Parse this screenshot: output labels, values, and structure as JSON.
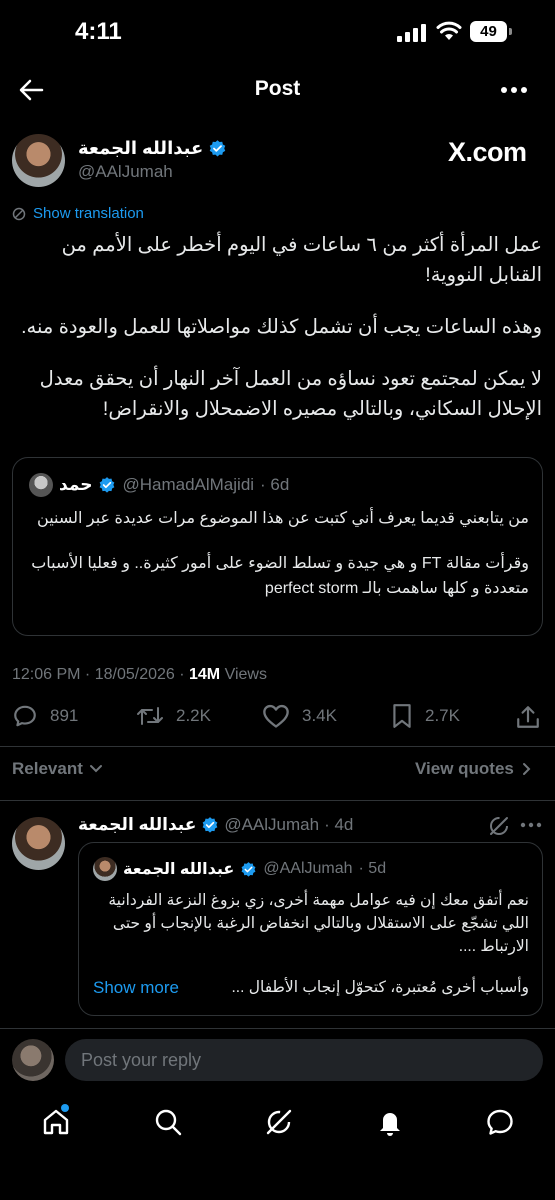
{
  "status_bar": {
    "time": "4:11",
    "battery": "49"
  },
  "header": {
    "title": "Post"
  },
  "post": {
    "display_name": "عبدالله الجمعة",
    "handle": "@AAlJumah",
    "watermark": "X.com",
    "translate_label": "Show translation",
    "paragraphs": [
      "عمل المرأة أكثر من ٦ ساعات في اليوم أخطر على الأمم من القنابل النووية!",
      "وهذه الساعات يجب أن تشمل كذلك مواصلاتها للعمل والعودة منه.",
      "لا يمكن لمجتمع تعود نساؤه من العمل آخر النهار أن يحقق معدل الإحلال السكاني، وبالتالي مصيره الاضمحلال والانقراض!"
    ],
    "quoted": {
      "display_name": "حمد",
      "handle": "@HamadAlMajidi",
      "time": "· 6d",
      "paragraphs": [
        "من يتابعني قديما يعرف أني كتبت عن هذا الموضوع مرات عديدة عبر السنين",
        "وقرأت مقالة FT و هي جيدة و تسلط الضوء على أمور كثيرة.. و فعليا الأسباب متعددة و كلها ساهمت بالـ perfect storm"
      ]
    },
    "meta": {
      "time_date": "12:06 PM · 18/05/2026 · ",
      "views_count": "14M",
      "views_label": " Views"
    },
    "stats": {
      "replies": "891",
      "reposts": "2.2K",
      "likes": "3.4K",
      "bookmarks": "2.7K"
    }
  },
  "sort": {
    "relevant_label": "Relevant",
    "view_quotes_label": "View quotes"
  },
  "reply": {
    "display_name": "عبدالله الجمعة",
    "handle": "@AAlJumah",
    "time": "· 4d",
    "quoted": {
      "display_name": "عبدالله الجمعة",
      "handle": "@AAlJumah",
      "time": "· 5d",
      "paragraphs": [
        "نعم أتفق معك إن فيه عوامل مهمة أخرى، زي بزوغ النزعة الفردانية اللي تشجّع على الاستقلال وبالتالي انخفاض الرغبة بالإنجاب أو حتى الارتباط ....",
        "وأسباب أخرى مُعتبرة، كتحوّل إنجاب الأطفال ..."
      ],
      "show_more": "Show more"
    }
  },
  "composer": {
    "placeholder": "Post your reply"
  },
  "colors": {
    "accent": "#1d9bf0",
    "background": "#000000",
    "muted": "#71767b",
    "border": "#2f3336"
  }
}
